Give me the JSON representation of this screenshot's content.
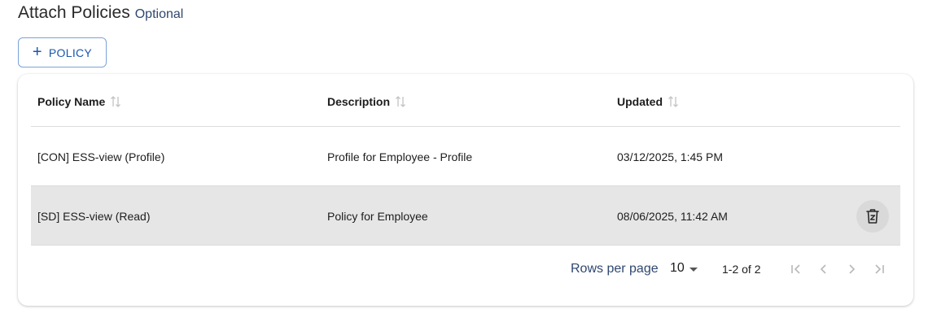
{
  "section": {
    "title": "Attach Policies",
    "optional_label": "Optional"
  },
  "add_button": {
    "icon": "plus-icon",
    "label": "POLICY"
  },
  "table": {
    "columns": [
      {
        "label": "Policy Name",
        "sort_icon": "sort-icon"
      },
      {
        "label": "Description",
        "sort_icon": "sort-icon"
      },
      {
        "label": "Updated",
        "sort_icon": "sort-icon"
      }
    ],
    "rows": [
      {
        "name": "[CON] ESS-view (Profile)",
        "description": "Profile for Employee - Profile",
        "updated": "03/12/2025, 1:45 PM",
        "highlighted": false
      },
      {
        "name": "[SD] ESS-view (Read)",
        "description": "Policy for Employee",
        "updated": "08/06/2025, 11:42 AM",
        "highlighted": true,
        "action_icon": "trash-icon"
      }
    ]
  },
  "pagination": {
    "rows_per_page_label": "Rows per page",
    "rows_per_page_value": "10",
    "range_text": "1-2 of 2",
    "icons": [
      "first-page-icon",
      "previous-page-icon",
      "next-page-icon",
      "last-page-icon"
    ]
  },
  "colors": {
    "accent": "#1a56b0",
    "button_border": "#7aa3d8",
    "muted_text": "#2f4770",
    "hover_row": "#e6e6e6",
    "disabled_icon": "#b8b8b8"
  }
}
